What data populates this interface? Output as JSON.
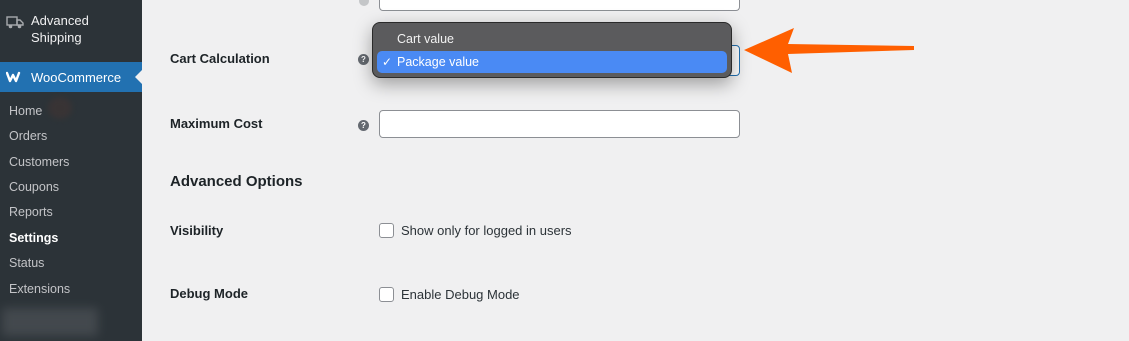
{
  "sidebar": {
    "top_item": {
      "label": "Advanced Shipping",
      "icon": "truck-icon"
    },
    "active_menu": {
      "label": "WooCommerce",
      "icon": "woocommerce-icon"
    },
    "submenu": [
      {
        "label": "Home",
        "active": false
      },
      {
        "label": "Orders",
        "active": false
      },
      {
        "label": "Customers",
        "active": false
      },
      {
        "label": "Coupons",
        "active": false
      },
      {
        "label": "Reports",
        "active": false
      },
      {
        "label": "Settings",
        "active": true
      },
      {
        "label": "Status",
        "active": false
      },
      {
        "label": "Extensions",
        "active": false
      }
    ]
  },
  "form": {
    "cart_calculation": {
      "label": "Cart Calculation",
      "options": [
        "Cart value",
        "Package value"
      ],
      "selected": "Package value",
      "check_glyph": "✓"
    },
    "maximum_cost": {
      "label": "Maximum Cost",
      "value": ""
    },
    "advanced_options_title": "Advanced Options",
    "visibility": {
      "label": "Visibility",
      "checkbox_label": "Show only for logged in users",
      "checked": false
    },
    "debug_mode": {
      "label": "Debug Mode",
      "checkbox_label": "Enable Debug Mode",
      "checked": false
    }
  },
  "colors": {
    "sidebar_bg": "#1d2327",
    "accent_blue": "#2271b1",
    "arrow_orange": "#ff5f00",
    "dropdown_selected": "#4a8af4"
  }
}
